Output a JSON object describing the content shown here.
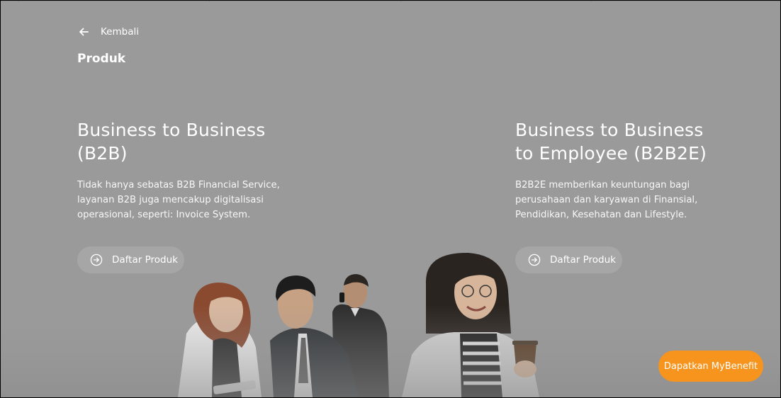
{
  "nav": {
    "back_label": "Kembali",
    "back_icon": "arrow-left-icon"
  },
  "page": {
    "title": "Produk"
  },
  "products": [
    {
      "title_line1": "Business to Business",
      "title_line2": "(B2B)",
      "description_line1": "Tidak hanya sebatas B2B Financial Service,",
      "description_line2": "layanan B2B juga mencakup digitalisasi",
      "description_line3": "operasional, seperti: Invoice System.",
      "button_label": "Daftar Produk",
      "button_icon": "arrow-right-circle-icon"
    },
    {
      "title_line1": "Business to Business",
      "title_line2": "to Employee (B2B2E)",
      "description_line1": "B2B2E memberikan keuntungan bagi",
      "description_line2": "perusahaan dan karyawan di Finansial,",
      "description_line3": "Pendidikan, Kesehatan dan Lifestyle.",
      "button_label": "Daftar Produk",
      "button_icon": "arrow-right-circle-icon"
    }
  ],
  "cta": {
    "label": "Dapatkan MyBenefit",
    "color": "#f7941d"
  },
  "colors": {
    "overlay_background": "#9a9a9a",
    "text": "#ffffff"
  }
}
